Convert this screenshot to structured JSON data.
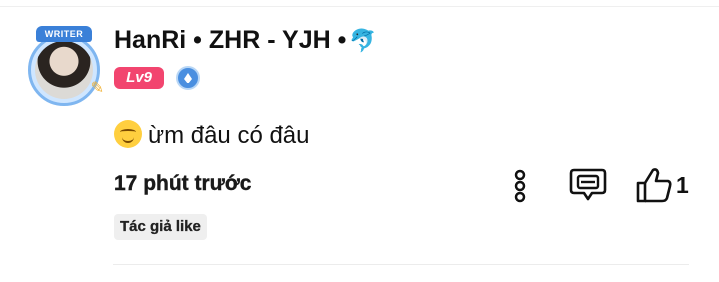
{
  "comment": {
    "avatar": {
      "badge_label": "WRITER"
    },
    "username": "HanRi • ZHR - YJH •",
    "username_icon": "dolphin-icon",
    "level": "Lv9",
    "verify_icon": "verified-badge-icon",
    "emoji": "relieved-face-emoji",
    "text": "ừm đâu có đâu",
    "time": "17 phút trước",
    "actions": {
      "more_icon": "more-vertical-icon",
      "reply_icon": "reply-comment-icon",
      "like_icon": "thumbs-up-icon",
      "like_count": "1"
    },
    "author_liked_label": "Tác giả like"
  },
  "colors": {
    "level_badge": "#f2456f",
    "verify_icon": "#4a8fe0",
    "writer_badge": "#3a80d8",
    "tag_background": "#efefef"
  }
}
